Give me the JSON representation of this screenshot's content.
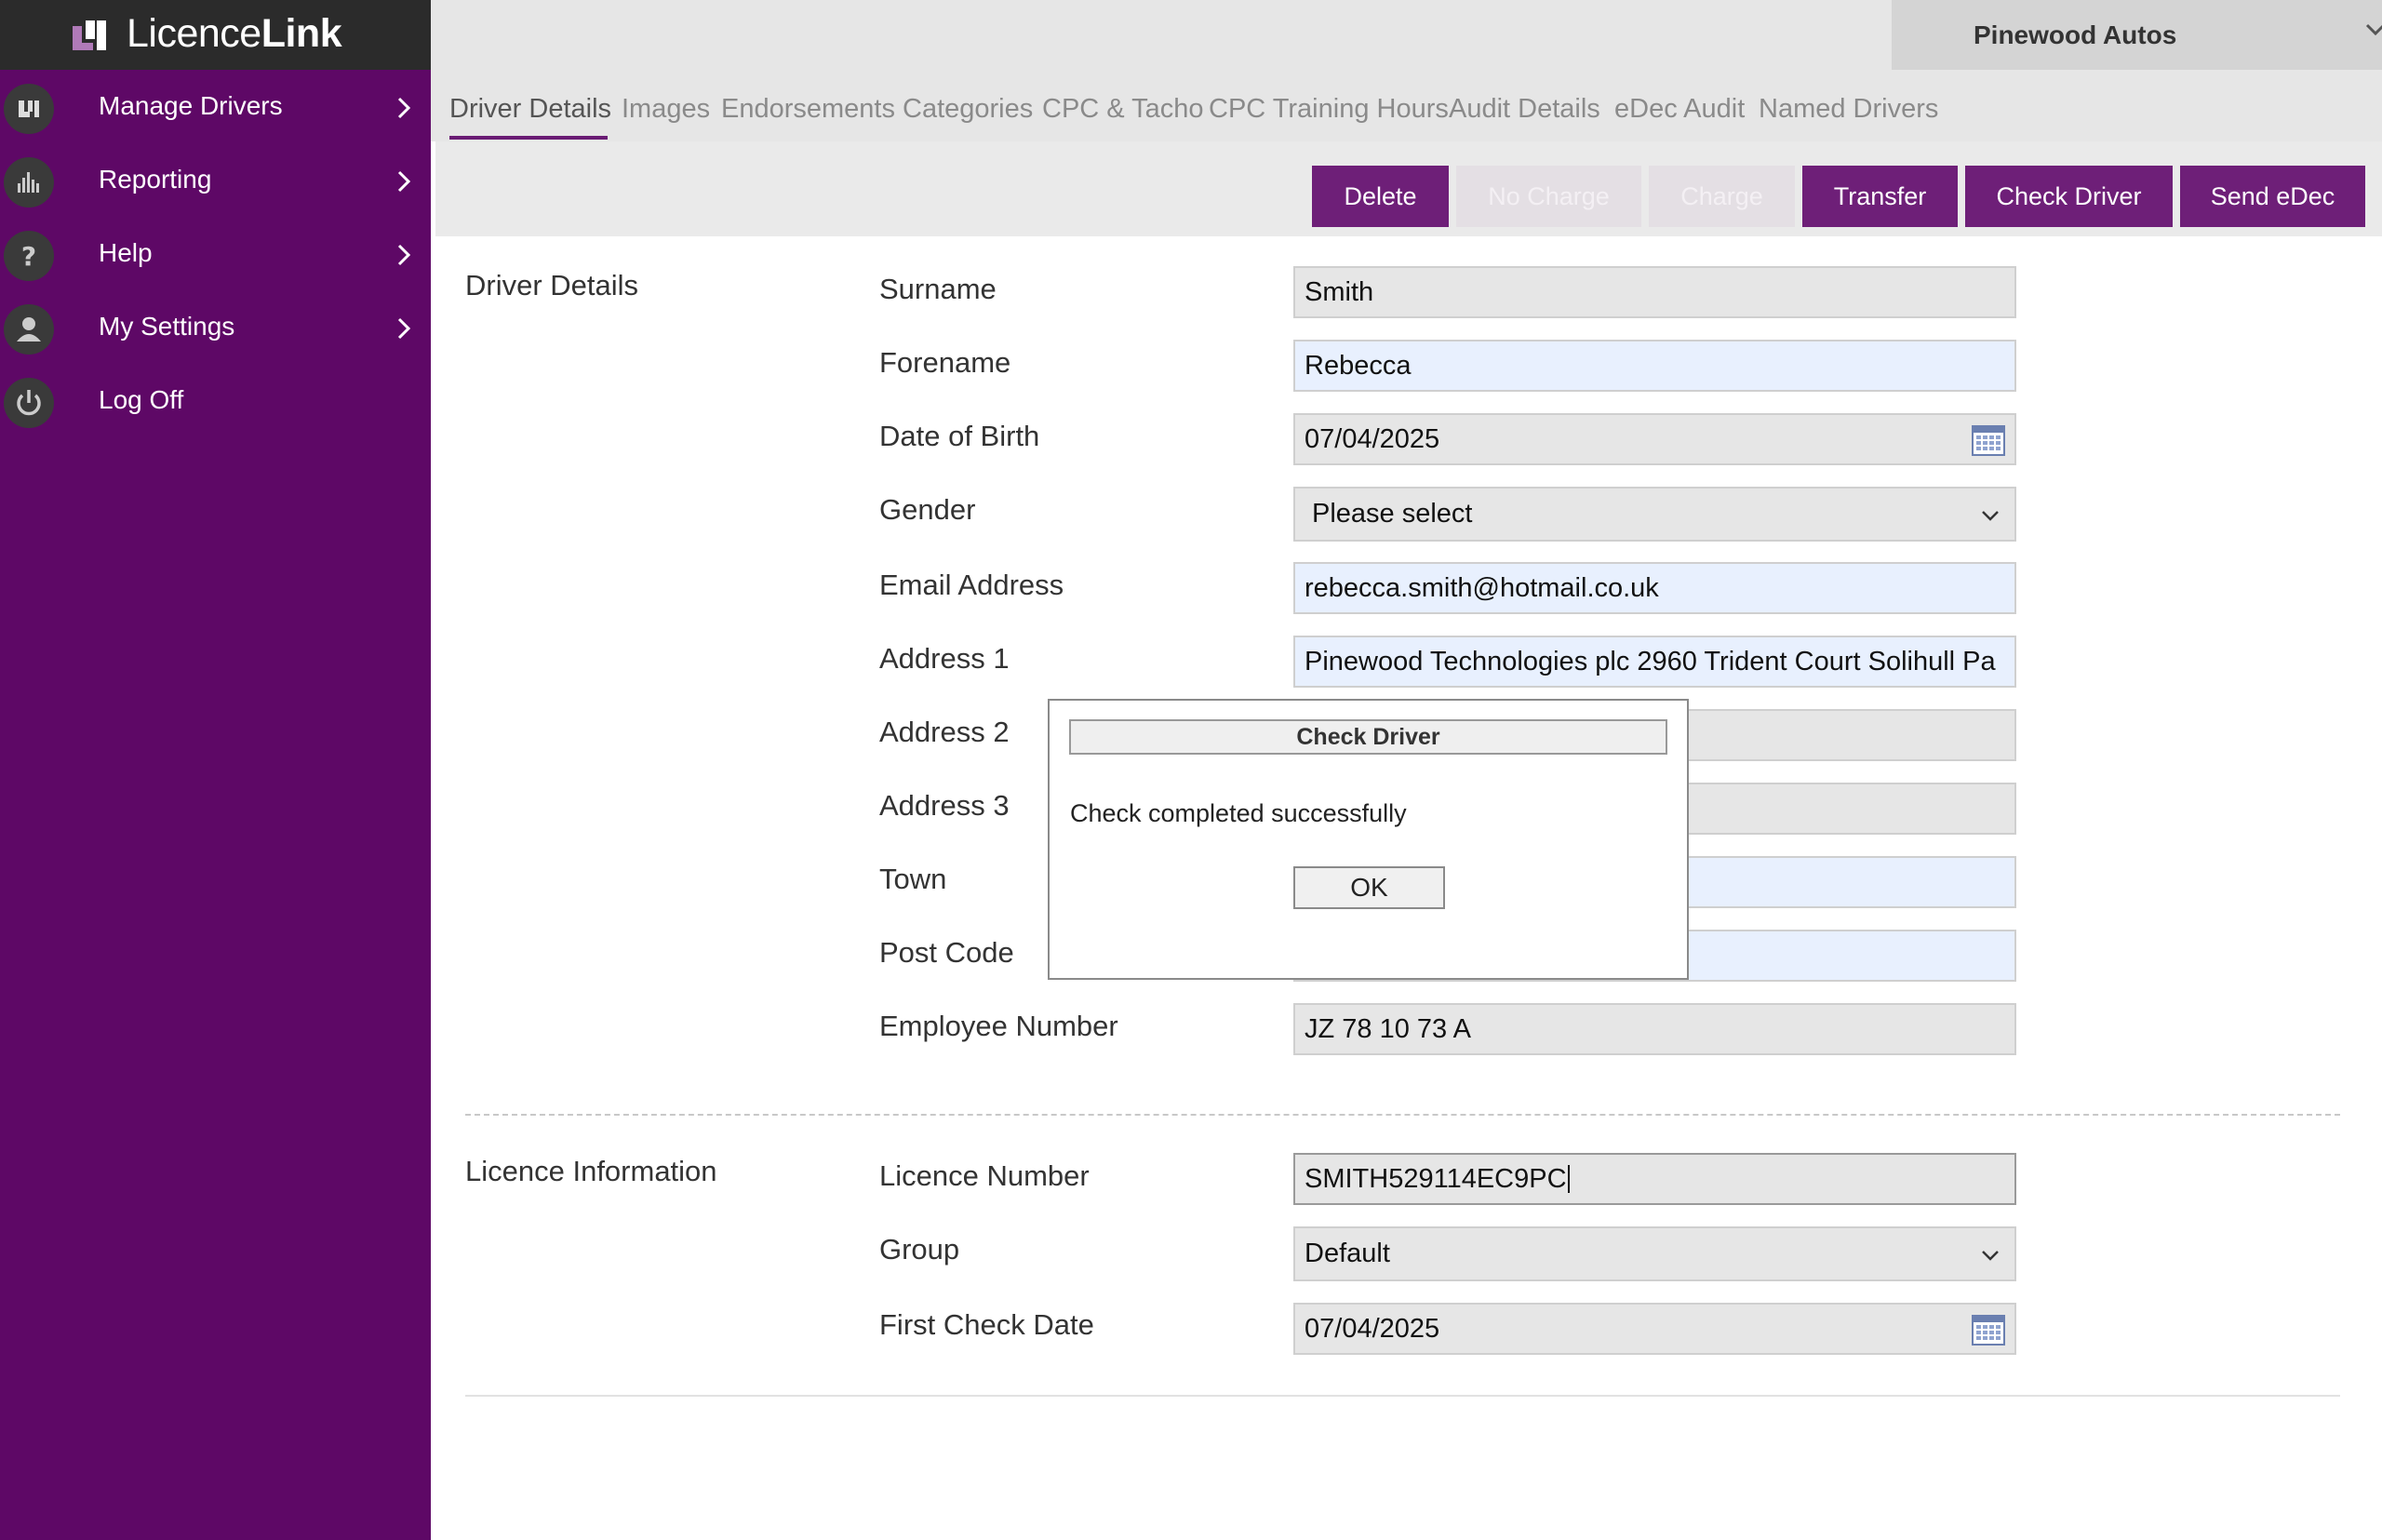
{
  "app": {
    "logo_text_light": "Licence",
    "logo_text_bold": "Link",
    "brand_color": "#5e0866",
    "accent_color": "#6e1f78"
  },
  "sidebar": {
    "items": [
      {
        "label": "Manage Drivers",
        "icon": "logo-mark-icon"
      },
      {
        "label": "Reporting",
        "icon": "bar-chart-icon"
      },
      {
        "label": "Help",
        "icon": "question-icon"
      },
      {
        "label": "My Settings",
        "icon": "user-icon"
      },
      {
        "label": "Log Off",
        "icon": "power-icon"
      }
    ]
  },
  "header": {
    "company": "Pinewood Autos"
  },
  "tabs": [
    "Driver Details",
    "Images",
    "Endorsements",
    "Categories",
    "CPC & Tacho",
    "CPC Training Hours",
    "Audit Details",
    "eDec Audit",
    "Named Drivers"
  ],
  "active_tab": "Driver Details",
  "toolbar": {
    "delete": "Delete",
    "no_charge": "No Charge",
    "charge": "Charge",
    "transfer": "Transfer",
    "check_driver": "Check Driver",
    "send_edec": "Send eDec"
  },
  "driver_details": {
    "section_title": "Driver Details",
    "labels": {
      "surname": "Surname",
      "forename": "Forename",
      "dob": "Date of Birth",
      "gender": "Gender",
      "email": "Email Address",
      "address1": "Address 1",
      "address2": "Address 2",
      "address3": "Address 3",
      "town": "Town",
      "postcode": "Post Code",
      "employee_number": "Employee Number"
    },
    "values": {
      "surname": "Smith",
      "forename": "Rebecca",
      "dob": "07/04/2025",
      "gender": "Please select",
      "email": "rebecca.smith@hotmail.co.uk",
      "address1": "Pinewood Technologies plc 2960 Trident Court Solihull Pa",
      "address2": "",
      "address3": "",
      "town": "",
      "postcode": "",
      "employee_number": "JZ 78 10 73 A"
    }
  },
  "licence_info": {
    "section_title": "Licence Information",
    "labels": {
      "licence_number": "Licence Number",
      "group": "Group",
      "first_check_date": "First Check Date"
    },
    "values": {
      "licence_number": "SMITH529114EC9PC",
      "group": "Default",
      "first_check_date": "07/04/2025"
    }
  },
  "dialog": {
    "title": "Check Driver",
    "message": "Check completed successfully",
    "ok": "OK"
  }
}
